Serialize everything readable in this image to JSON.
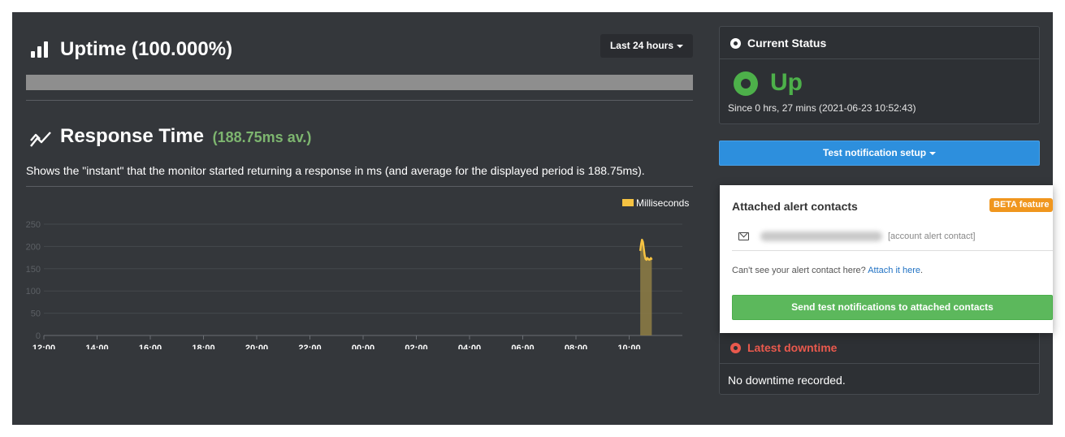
{
  "uptime": {
    "title": "Uptime (100.000%)",
    "range_label": "Last 24 hours",
    "bar_color": "#8e8e8e",
    "uptime_fraction": 1.0
  },
  "response": {
    "title": "Response Time",
    "average_label": "(188.75ms av.)",
    "description": "Shows the \"instant\" that the monitor started returning a response in ms (and average for the displayed period is 188.75ms)."
  },
  "chart_data": {
    "type": "area",
    "legend": [
      {
        "name": "Milliseconds",
        "color": "#f5c242"
      }
    ],
    "legend_position": "top-right",
    "yticks": [
      0,
      50,
      100,
      150,
      200,
      250
    ],
    "ylim": [
      0,
      250
    ],
    "xticks": [
      "12:00",
      "14:00",
      "16:00",
      "18:00",
      "20:00",
      "22:00",
      "00:00",
      "02:00",
      "04:00",
      "06:00",
      "08:00",
      "10:00"
    ],
    "grid": true,
    "series": [
      {
        "name": "Milliseconds",
        "x": [
          "10:25",
          "10:27",
          "10:29",
          "10:31",
          "10:33",
          "10:35",
          "10:37",
          "10:39",
          "10:41",
          "10:43",
          "10:45",
          "10:47",
          "10:49",
          "10:51"
        ],
        "values": [
          190,
          205,
          215,
          210,
          195,
          180,
          172,
          170,
          174,
          172,
          170,
          171,
          174,
          170
        ]
      }
    ]
  },
  "status": {
    "title": "Current Status",
    "state": "Up",
    "since": "Since 0 hrs, 27 mins (2021-06-23 10:52:43)",
    "color": "#4db04a"
  },
  "test_button": {
    "label": "Test notification setup"
  },
  "alert_popup": {
    "title": "Attached alert contacts",
    "badge": "BETA feature",
    "contact_tag": "[account alert contact]",
    "hint_text": "Can't see your alert contact here?",
    "hint_link": "Attach it here",
    "hint_end": ".",
    "send_label": "Send test notifications to attached contacts"
  },
  "downtime": {
    "title": "Latest downtime",
    "text": "No downtime recorded.",
    "color": "#e9594d"
  }
}
